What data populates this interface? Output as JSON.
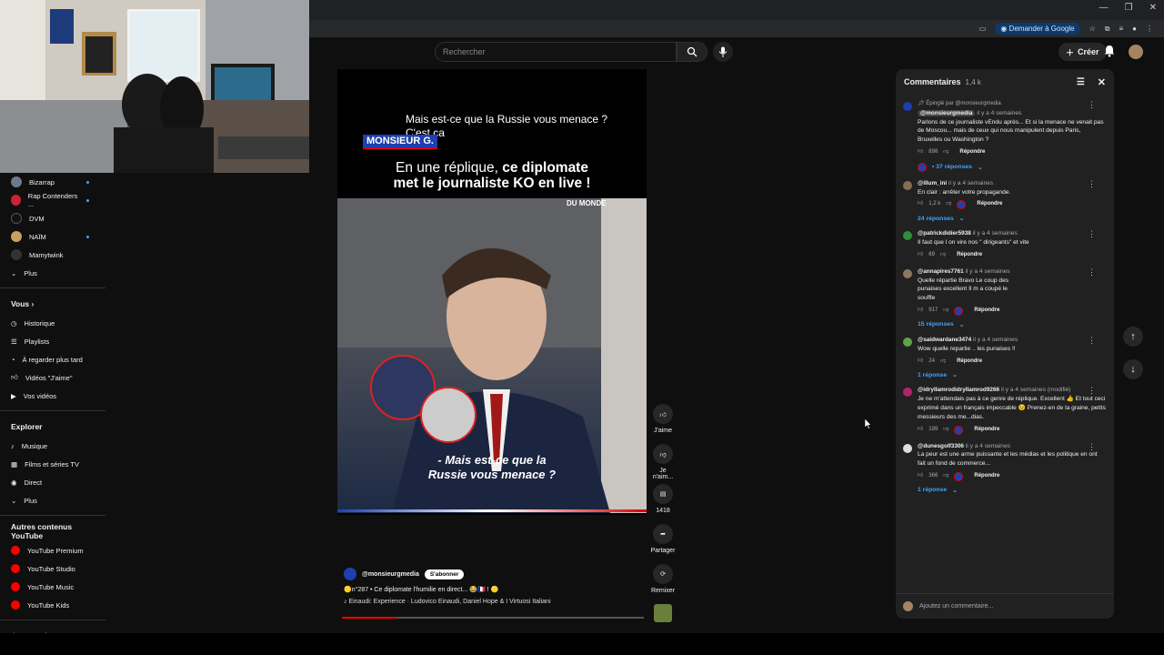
{
  "browser": {
    "gemini_label": "Demander à Google",
    "win_controls": [
      "—",
      "❐",
      "✕"
    ]
  },
  "topbar": {
    "search_placeholder": "Rechercher",
    "create_label": "Créer"
  },
  "sidebar": {
    "subscriptions": [
      {
        "label": "Bizarrap",
        "new": true
      },
      {
        "label": "Rap Contenders ...",
        "new": true
      },
      {
        "label": "DVM",
        "new": false
      },
      {
        "label": "NAÏM",
        "new": true
      },
      {
        "label": "Mamytwink",
        "new": false
      }
    ],
    "more_label": "Plus",
    "you_header": "Vous",
    "you_items": [
      "Historique",
      "Playlists",
      "À regarder plus tard",
      "Vidéos \"J'aime\"",
      "Vos vidéos"
    ],
    "explore_header": "Explorer",
    "explore_items": [
      "Musique",
      "Films et séries TV",
      "Direct",
      "Plus"
    ],
    "other_header": "Autres contenus YouTube",
    "other_items": [
      "YouTube Premium",
      "YouTube Studio",
      "YouTube Music",
      "YouTube Kids"
    ],
    "settings_label": "Paramètres"
  },
  "video": {
    "overlay_line1": "Mais est-ce que la Russie vous menace ?",
    "overlay_line2": "C'est ca",
    "brand_tag": "MONSIEUR G.",
    "title_normal": "En une réplique, ",
    "title_bold": "ce diplomate",
    "title_line2": "met le journaliste KO en live !",
    "watermark": "DU MONDE",
    "caption_line1": "- Mais est-ce que la",
    "caption_line2": "Russie vous menace ?",
    "channel": "@monsieurgmedia",
    "subscribe": "S'abonner",
    "description": "🟡n°287 • Ce diplomate l'humilie en direct... 😂🇫🇷 ! 🟡",
    "music": "♪ Einaudi: Experience · Ludovico Einaudi, Daniel Hope & I Virtuosi Italiani",
    "progress": 0.18
  },
  "actions": {
    "like": "J'aime",
    "dislike": "Je n'aim...",
    "comments_count": "1418",
    "share": "Partager",
    "remix": "Remixer"
  },
  "comments": {
    "title": "Commentaires",
    "count": "1,4 k",
    "add_placeholder": "Ajoutez un commentaire...",
    "reply_label": "Répondre",
    "pinned_label": "Épinglé par @monsieurgmedia",
    "items": [
      {
        "author": "@monsieurgmedia",
        "time": "il y a 4 semaines",
        "text": "Parlons de ce journaliste vEndu après... Et si la menace ne venait pas de Moscou... mais de ceux qui nous manipulent depuis Paris, Bruxelles ou Washington ?",
        "likes": "898",
        "replies": "37 réponses",
        "color": "#1f3fb0"
      },
      {
        "author": "@illum_ini",
        "time": "il y a 4 semaines",
        "text": "En clair : arrêter votre propagande.",
        "likes": "1,2 k",
        "replies": "24 réponses",
        "color": "#8a6d4e"
      },
      {
        "author": "@patrickdidier5938",
        "time": "il y a 4 semaines",
        "text": "Il faut que l on vire nos \" dirigeants\" et vite",
        "likes": "69",
        "replies": "",
        "color": "#2f8f3a"
      },
      {
        "author": "@annapires7761",
        "time": "il y a 4 semaines",
        "text": "Quelle répartie Bravo Le coup des punaises excellent Il m a coupé le souffle",
        "likes": "917",
        "replies": "15 réponses",
        "color": "#8d7760"
      },
      {
        "author": "@saidwardane3474",
        "time": "il y a 4 semaines",
        "text": "Wow quelle repartie .. les punaises !!",
        "likes": "24",
        "replies": "1 réponse",
        "color": "#5fa34a"
      },
      {
        "author": "@idryllamrodidryllamrod9266",
        "time": "il y a 4 semaines (modifié)",
        "text": "Je ne m'attendais pas à ce genre de réplique. Excellent 👍 Et tout ceci exprimé dans un français impeccable 😉 Prenez-en de la graine, petits messieurs des me...dias.",
        "likes": "199",
        "replies": "",
        "color": "#b0246a"
      },
      {
        "author": "@dunesgolf3306",
        "time": "il y a 4 semaines",
        "text": "La peur est une arme puissante et les médias et les politique en ont fait un fond de commerce...",
        "likes": "366",
        "replies": "1 réponse",
        "color": "#dddddd"
      }
    ]
  }
}
